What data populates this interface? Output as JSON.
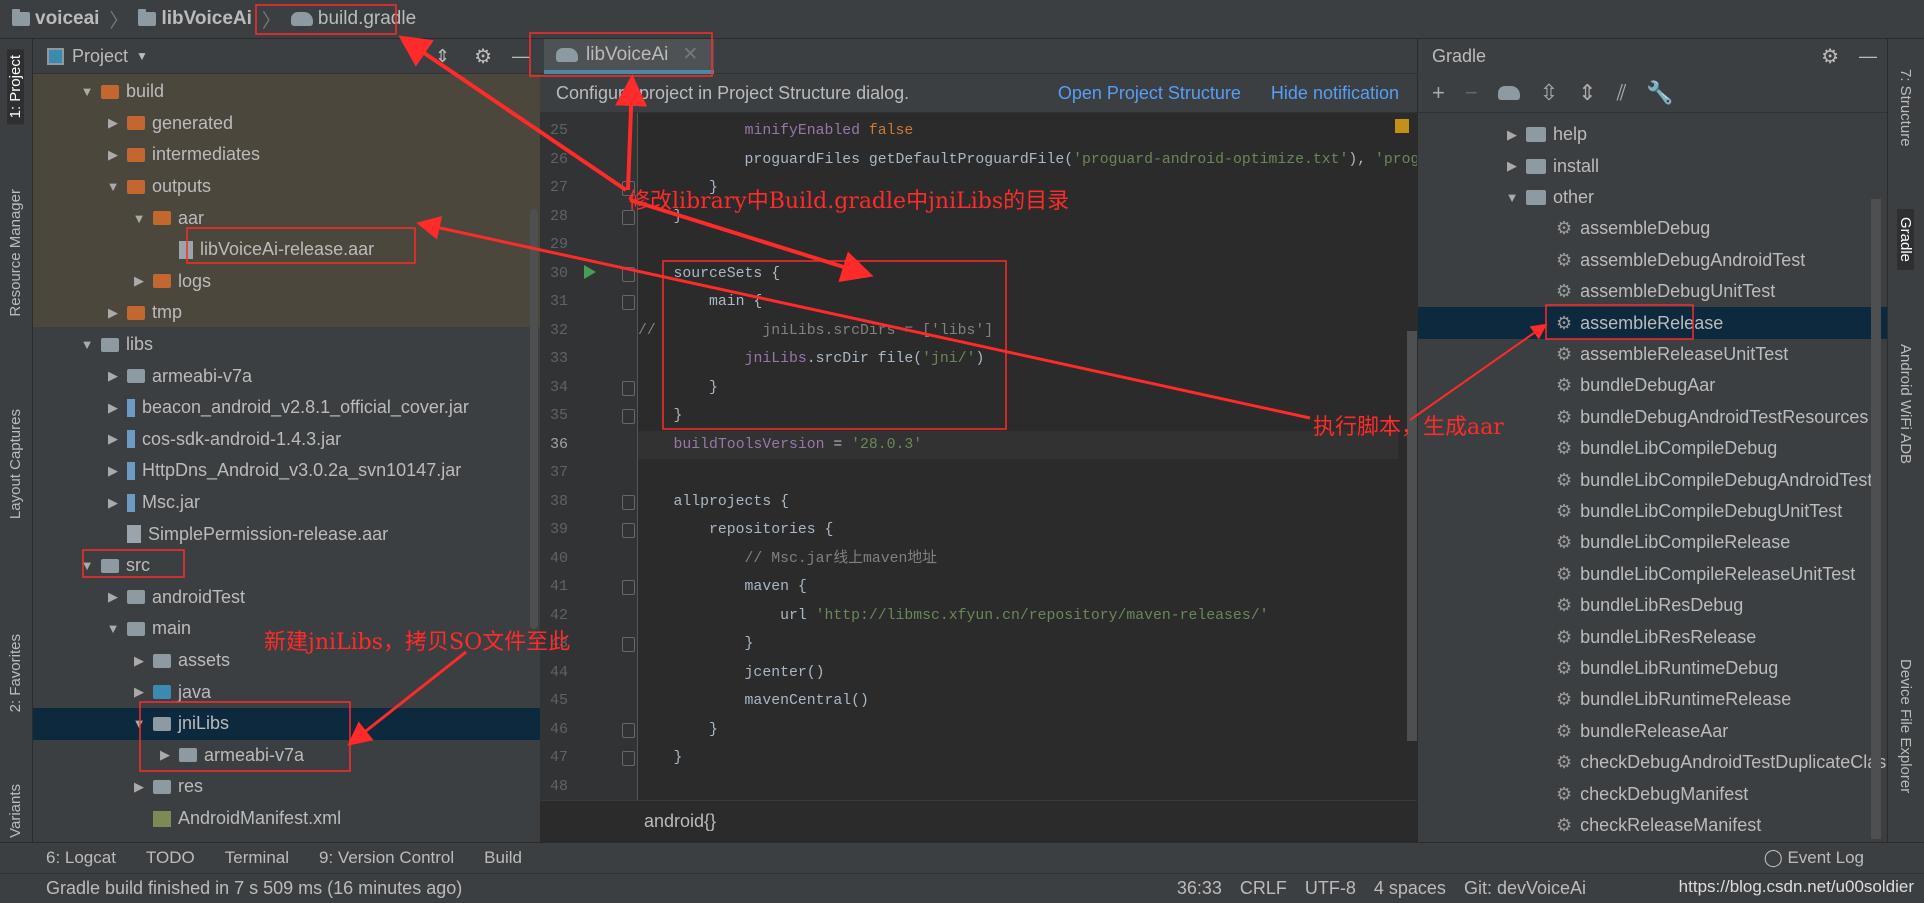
{
  "breadcrumb": [
    "voiceai",
    "libVoiceAi",
    "build.gradle"
  ],
  "left_stripe": [
    "1: Project",
    "Resource Manager",
    "Layout Captures",
    "2: Favorites",
    "Build Variants"
  ],
  "right_stripe": [
    "7: Structure",
    "Gradle",
    "Android WiFi ADB",
    "Device File Explorer"
  ],
  "project_panel": {
    "title": "Project",
    "tree": [
      {
        "label": "build",
        "level": 1,
        "state": "open",
        "icon": "folder-orange"
      },
      {
        "label": "generated",
        "level": 2,
        "state": "closed",
        "icon": "folder-orange"
      },
      {
        "label": "intermediates",
        "level": 2,
        "state": "closed",
        "icon": "folder-orange"
      },
      {
        "label": "outputs",
        "level": 2,
        "state": "open",
        "icon": "folder-orange"
      },
      {
        "label": "aar",
        "level": 3,
        "state": "open",
        "icon": "folder-orange"
      },
      {
        "label": "libVoiceAi-release.aar",
        "level": 4,
        "state": "leaf",
        "icon": "file"
      },
      {
        "label": "logs",
        "level": 3,
        "state": "closed",
        "icon": "folder-orange"
      },
      {
        "label": "tmp",
        "level": 2,
        "state": "closed",
        "icon": "folder-orange"
      },
      {
        "label": "libs",
        "level": 1,
        "state": "open",
        "icon": "folder-gray"
      },
      {
        "label": "armeabi-v7a",
        "level": 2,
        "state": "closed",
        "icon": "folder-gray"
      },
      {
        "label": "beacon_android_v2.8.1_official_cover.jar",
        "level": 2,
        "state": "closed",
        "icon": "jar"
      },
      {
        "label": "cos-sdk-android-1.4.3.jar",
        "level": 2,
        "state": "closed",
        "icon": "jar"
      },
      {
        "label": "HttpDns_Android_v3.0.2a_svn10147.jar",
        "level": 2,
        "state": "closed",
        "icon": "jar"
      },
      {
        "label": "Msc.jar",
        "level": 2,
        "state": "closed",
        "icon": "jar"
      },
      {
        "label": "SimplePermission-release.aar",
        "level": 2,
        "state": "leaf",
        "icon": "file"
      },
      {
        "label": "src",
        "level": 1,
        "state": "open",
        "icon": "folder-gray"
      },
      {
        "label": "androidTest",
        "level": 2,
        "state": "closed",
        "icon": "folder-gray"
      },
      {
        "label": "main",
        "level": 2,
        "state": "open",
        "icon": "folder-gray"
      },
      {
        "label": "assets",
        "level": 3,
        "state": "closed",
        "icon": "folder-gray"
      },
      {
        "label": "java",
        "level": 3,
        "state": "closed",
        "icon": "folder-blue"
      },
      {
        "label": "jniLibs",
        "level": 3,
        "state": "open",
        "icon": "folder-gray",
        "selected": true
      },
      {
        "label": "armeabi-v7a",
        "level": 4,
        "state": "closed",
        "icon": "folder-gray"
      },
      {
        "label": "res",
        "level": 3,
        "state": "closed",
        "icon": "folder-gray"
      },
      {
        "label": "AndroidManifest.xml",
        "level": 3,
        "state": "leaf",
        "icon": "manifest"
      }
    ]
  },
  "editor": {
    "tab": "libVoiceAi",
    "notification": {
      "text": "Configure project in Project Structure dialog.",
      "link1": "Open Project Structure",
      "link2": "Hide notification"
    },
    "current_line": 36,
    "lines": [
      {
        "n": 25,
        "t": [
          [
            "            ",
            "n"
          ],
          [
            "minifyEnabled ",
            "p"
          ],
          [
            "false",
            "k"
          ]
        ]
      },
      {
        "n": 26,
        "t": [
          [
            "            proguardFiles getDefaultProguardFile(",
            "n"
          ],
          [
            "'proguard-android-optimize.txt'",
            "s"
          ],
          [
            "), ",
            "n"
          ],
          [
            "'proguard-rules.pro'",
            "s"
          ]
        ]
      },
      {
        "n": 27,
        "t": [
          [
            "        }",
            "n"
          ]
        ]
      },
      {
        "n": 28,
        "t": [
          [
            "    }",
            "n"
          ]
        ]
      },
      {
        "n": 29,
        "t": []
      },
      {
        "n": 30,
        "t": [
          [
            "    sourceSets {",
            "n"
          ]
        ]
      },
      {
        "n": 31,
        "t": [
          [
            "        main {",
            "n"
          ]
        ]
      },
      {
        "n": 32,
        "t": [
          [
            "//            jniLibs.srcDirs = ['libs']",
            "c"
          ]
        ]
      },
      {
        "n": 33,
        "t": [
          [
            "            ",
            "n"
          ],
          [
            "jniLibs",
            "p"
          ],
          [
            ".srcDir file(",
            "n"
          ],
          [
            "'jni/'",
            "s"
          ],
          [
            ")",
            "n"
          ]
        ]
      },
      {
        "n": 34,
        "t": [
          [
            "        }",
            "n"
          ]
        ]
      },
      {
        "n": 35,
        "t": [
          [
            "    }",
            "n"
          ]
        ]
      },
      {
        "n": 36,
        "t": [
          [
            "    ",
            "n"
          ],
          [
            "buildToolsVersion",
            "p"
          ],
          [
            " = ",
            "n"
          ],
          [
            "'28.0.3'",
            "s"
          ]
        ]
      },
      {
        "n": 37,
        "t": []
      },
      {
        "n": 38,
        "t": [
          [
            "    allprojects {",
            "n"
          ]
        ]
      },
      {
        "n": 39,
        "t": [
          [
            "        repositories {",
            "n"
          ]
        ]
      },
      {
        "n": 40,
        "t": [
          [
            "            // Msc.jar线上maven地址",
            "c"
          ]
        ]
      },
      {
        "n": 41,
        "t": [
          [
            "            maven {",
            "n"
          ]
        ]
      },
      {
        "n": 42,
        "t": [
          [
            "                url ",
            "n"
          ],
          [
            "'http://libmsc.xfyun.cn/repository/maven-releases/'",
            "s"
          ]
        ]
      },
      {
        "n": 43,
        "t": [
          [
            "            }",
            "n"
          ]
        ]
      },
      {
        "n": 44,
        "t": [
          [
            "            jcenter()",
            "n"
          ]
        ]
      },
      {
        "n": 45,
        "t": [
          [
            "            mavenCentral()",
            "n"
          ]
        ]
      },
      {
        "n": 46,
        "t": [
          [
            "        }",
            "n"
          ]
        ]
      },
      {
        "n": 47,
        "t": [
          [
            "    }",
            "n"
          ]
        ]
      },
      {
        "n": 48,
        "t": []
      }
    ],
    "breadcrumb": "android{}"
  },
  "gradle_panel": {
    "title": "Gradle",
    "groups": [
      "help",
      "install",
      "other"
    ],
    "tasks": [
      "assembleDebug",
      "assembleDebugAndroidTest",
      "assembleDebugUnitTest",
      "assembleRelease",
      "assembleReleaseUnitTest",
      "bundleDebugAar",
      "bundleDebugAndroidTestResources",
      "bundleLibCompileDebug",
      "bundleLibCompileDebugAndroidTest",
      "bundleLibCompileDebugUnitTest",
      "bundleLibCompileRelease",
      "bundleLibCompileReleaseUnitTest",
      "bundleLibResDebug",
      "bundleLibResRelease",
      "bundleLibRuntimeDebug",
      "bundleLibRuntimeRelease",
      "bundleReleaseAar",
      "checkDebugAndroidTestDuplicateClasses",
      "checkDebugManifest",
      "checkReleaseManifest"
    ],
    "selected_task": "assembleRelease"
  },
  "bottom_tools": [
    "6: Logcat",
    "TODO",
    "Terminal",
    "9: Version Control",
    "Build"
  ],
  "event_log": "Event Log",
  "status": {
    "message": "Gradle build finished in 7 s 509 ms (16 minutes ago)",
    "position": "36:33",
    "line_sep": "CRLF",
    "encoding": "UTF-8",
    "indent": "4 spaces",
    "git": "Git: devVoiceAi"
  },
  "watermark": "https://blog.csdn.net/u00soldier",
  "annotations": {
    "a1": "修改library中Build.gradle中jniLibs的目录",
    "a2": "执行脚本，生成aar",
    "a3": "新建jniLibs，拷贝SO文件至此",
    "color": "#ff2a2a"
  },
  "colors": {
    "accent": "#4a88a5",
    "selection": "#0d293e",
    "build_highlight": "#4b473d",
    "link": "#589df6"
  }
}
